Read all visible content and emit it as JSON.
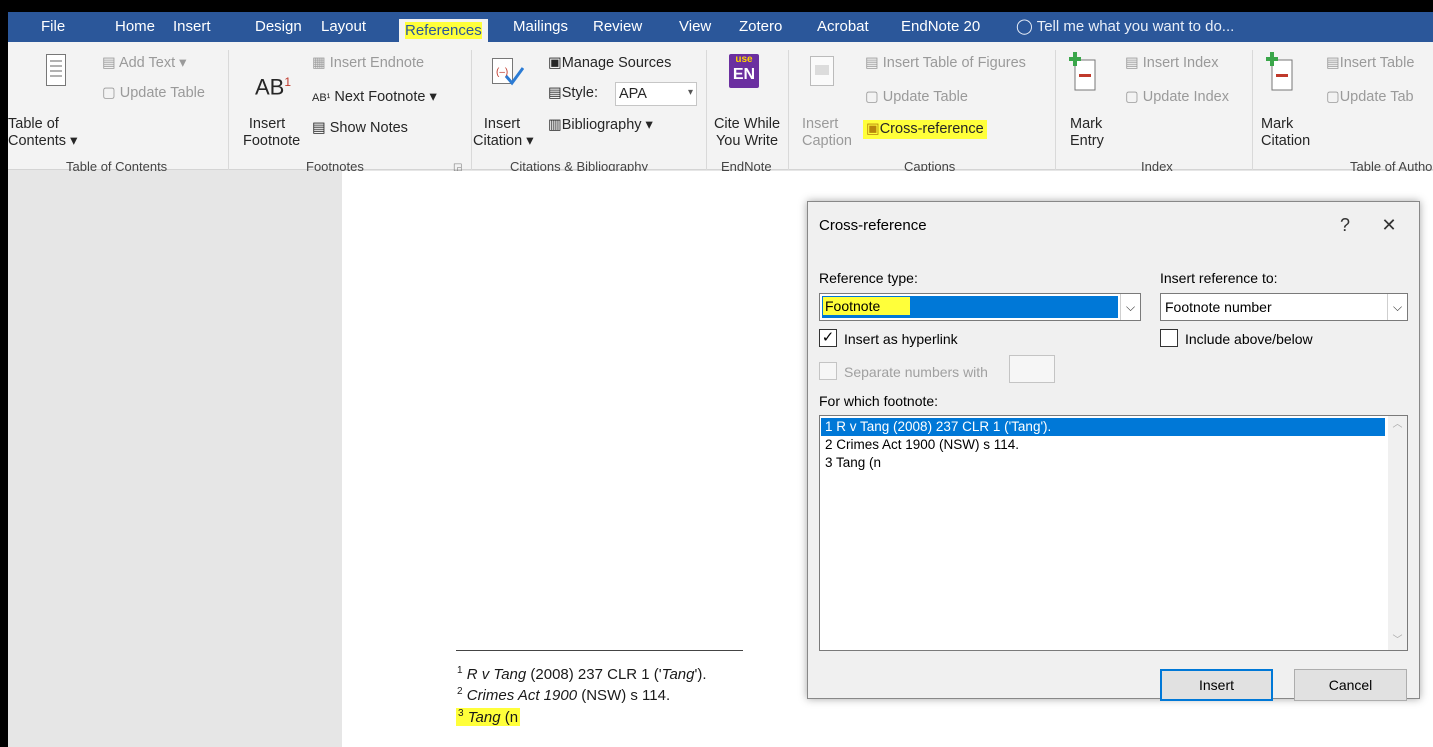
{
  "tabs": [
    "File",
    "Home",
    "Insert",
    "Design",
    "Layout",
    "References",
    "Mailings",
    "Review",
    "View",
    "Zotero",
    "Acrobat",
    "EndNote 20"
  ],
  "active_tab": "References",
  "tell_me": "Tell me what you want to do...",
  "ribbon": {
    "toc": {
      "label1": "Table of",
      "label2": "Contents",
      "add_text": "Add Text",
      "update_table": "Update Table",
      "group": "Table of Contents"
    },
    "footnotes": {
      "ab": "AB",
      "sup": "1",
      "insert1": "Insert",
      "insert2": "Footnote",
      "insert_endnote": "Insert Endnote",
      "next_footnote": "Next Footnote",
      "show_notes": "Show Notes",
      "group": "Footnotes"
    },
    "citations": {
      "insert1": "Insert",
      "insert2": "Citation",
      "manage_sources": "Manage Sources",
      "style_label": "Style:",
      "style_value": "APA",
      "bibliography": "Bibliography",
      "group": "Citations & Bibliography"
    },
    "endnote": {
      "icon_top": "use",
      "icon_bottom": "EN",
      "cite1": "Cite While",
      "cite2": "You Write",
      "group": "EndNote"
    },
    "captions": {
      "insert1": "Insert",
      "insert2": "Caption",
      "table_of_figures": "Insert Table of Figures",
      "update_table": "Update Table",
      "cross_reference": "Cross-reference",
      "group": "Captions"
    },
    "index": {
      "mark1": "Mark",
      "mark2": "Entry",
      "insert_index": "Insert Index",
      "update_index": "Update Index",
      "group": "Index"
    },
    "authorities": {
      "mark1": "Mark",
      "mark2": "Citation",
      "insert_table": "Insert Table",
      "update_table": "Update Tab",
      "group": "Table of Author"
    }
  },
  "document": {
    "footnotes": [
      {
        "num": "1",
        "italic1": "R v Tang",
        "text1": " (2008) 237 CLR 1 ('",
        "italic2": "Tang",
        "text2": "')."
      },
      {
        "num": "2",
        "italic1": "Crimes Act 1900",
        "text1": " (NSW) s 114."
      },
      {
        "num": "3",
        "italic1": "Tang",
        "text1": " (n"
      }
    ]
  },
  "dialog": {
    "title": "Cross-reference",
    "help": "?",
    "close": "✕",
    "reference_type_label": "Reference type:",
    "reference_type_value": "Footnote",
    "insert_reference_label": "Insert reference to:",
    "insert_reference_value": "Footnote number",
    "insert_hyperlink": "Insert as hyperlink",
    "include_above_below": "Include above/below",
    "separate_numbers": "Separate numbers with",
    "for_which_label": "For which footnote:",
    "list_items": [
      "1 R v Tang (2008) 237 CLR 1 ('Tang').",
      "2 Crimes Act 1900 (NSW) s 114.",
      "3 Tang (n"
    ],
    "insert_button": "Insert",
    "cancel_button": "Cancel"
  },
  "colors": {
    "tabbar": "#2b579a",
    "highlight": "#ffff3a",
    "selection": "#0078d7"
  }
}
